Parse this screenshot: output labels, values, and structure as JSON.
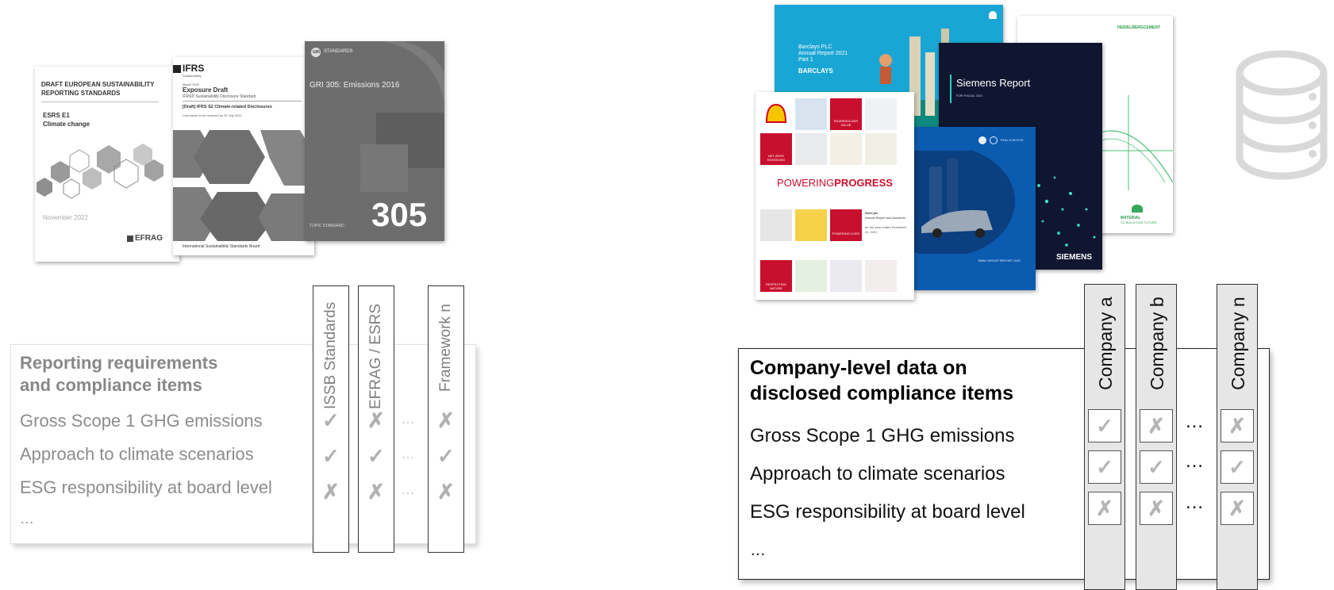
{
  "standards_docs": {
    "efrag": {
      "title_line1": "DRAFT EUROPEAN SUSTAINABILITY",
      "title_line2": "REPORTING STANDARDS",
      "code": "ESRS E1",
      "subtitle": "Climate change",
      "date": "November 2022",
      "logo": "EFRAG"
    },
    "ifrs": {
      "logo": "IFRS",
      "logo_sub": "Sustainability",
      "date_small": "March 2022",
      "doc_type": "Exposure Draft",
      "standard": "IFRS® Sustainability Disclosure Standard",
      "draft_title": "[Draft] IFRS S2 Climate-related Disclosures",
      "comments": "Comments to be received by 29 July 2022",
      "footer": "International Sustainability Standards Board"
    },
    "gri": {
      "logo": "GRI",
      "logo_text": "STANDARDS",
      "title": "GRI 305: Emissions 2016",
      "number": "305",
      "footer": "TOPIC STANDARD"
    }
  },
  "requirements_table": {
    "title_line1": "Reporting requirements",
    "title_line2": "and compliance items",
    "rows": [
      "Gross Scope 1 GHG emissions",
      "Approach to climate scenarios",
      "ESG responsibility at board level",
      "…"
    ],
    "columns": [
      "ISSB Standards",
      "EFRAG / ESRS",
      "Framework n"
    ],
    "gap": "…",
    "marks": [
      [
        "✓",
        "✗",
        "✗"
      ],
      [
        "✓",
        "✓",
        "✓"
      ],
      [
        "✗",
        "✗",
        "✗"
      ]
    ]
  },
  "company_reports": {
    "barclays": {
      "line1": "Barclays PLC",
      "line2": "Annual Report 2021",
      "line3": "Part 1",
      "brand": "BARCLAYS"
    },
    "siemens": {
      "title": "Siemens Report",
      "sub": "FOR FISCAL 2021",
      "brand": "SIEMENS"
    },
    "heidelberg": {
      "brand": "HEIDELBERGCEMENT",
      "tagline1": "MATERIAL",
      "tagline2": "TO BUILD OUR FUTURE"
    },
    "bmw": {
      "brand_right": "ROLLS-ROYCE",
      "footer": "BMW GROUP REPORT 2021"
    },
    "shell": {
      "banner_1": "POWERING",
      "banner_2": "PROGRESS",
      "tile_1": "SHAREHOLDER VALUE",
      "tile_2": "NET-ZERO EMISSIONS",
      "tile_3": "POWERING LIVES",
      "tile_4": "RESPECTING NATURE",
      "side_1": "Shell plc",
      "side_2": "Annual Report and Accounts",
      "side_3": "for the year ended December 31, 2021"
    }
  },
  "company_table": {
    "title_line1": "Company-level data on",
    "title_line2": "disclosed compliance items",
    "rows": [
      "Gross Scope 1 GHG emissions",
      "Approach to climate scenarios",
      "ESG responsibility at board level",
      "…"
    ],
    "columns": [
      "Company a",
      "Company b",
      "Company n"
    ],
    "gap": "…",
    "marks": [
      [
        "✓",
        "✗",
        "✗"
      ],
      [
        "✓",
        "✓",
        "✓"
      ],
      [
        "✗",
        "✗",
        "✗"
      ]
    ]
  },
  "icons": {
    "database": "database-icon"
  },
  "colors": {
    "shell_red": "#c8102e",
    "barclays_blue": "#1aa6d4",
    "siemens_navy": "#101530",
    "bmw_blue": "#0b5bb0",
    "grey_text": "#8c8c8c"
  }
}
